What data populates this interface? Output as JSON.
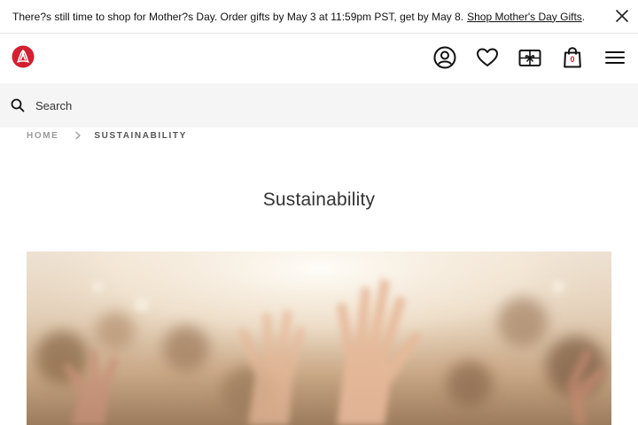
{
  "promo": {
    "message": "There?s still time to shop for Mother?s Day. Order gifts by May 3 at 11:59pm PST, get by May 8.",
    "link_label": "Shop Mother's Day Gifts",
    "link_suffix": ".",
    "close_icon": "close-icon"
  },
  "header": {
    "logo_icon": "lululemon-logo-icon",
    "icons": [
      "account-icon",
      "heart-icon",
      "gift-card-icon",
      "bag-icon",
      "menu-icon"
    ],
    "bag_count": "0",
    "brand_color": "#d22030"
  },
  "search": {
    "placeholder": "Search",
    "value": "",
    "icon": "search-icon"
  },
  "breadcrumb": {
    "home": "HOME",
    "current": "SUSTAINABILITY"
  },
  "page": {
    "title": "Sustainability"
  },
  "hero": {
    "description_icon": "hero-image"
  }
}
